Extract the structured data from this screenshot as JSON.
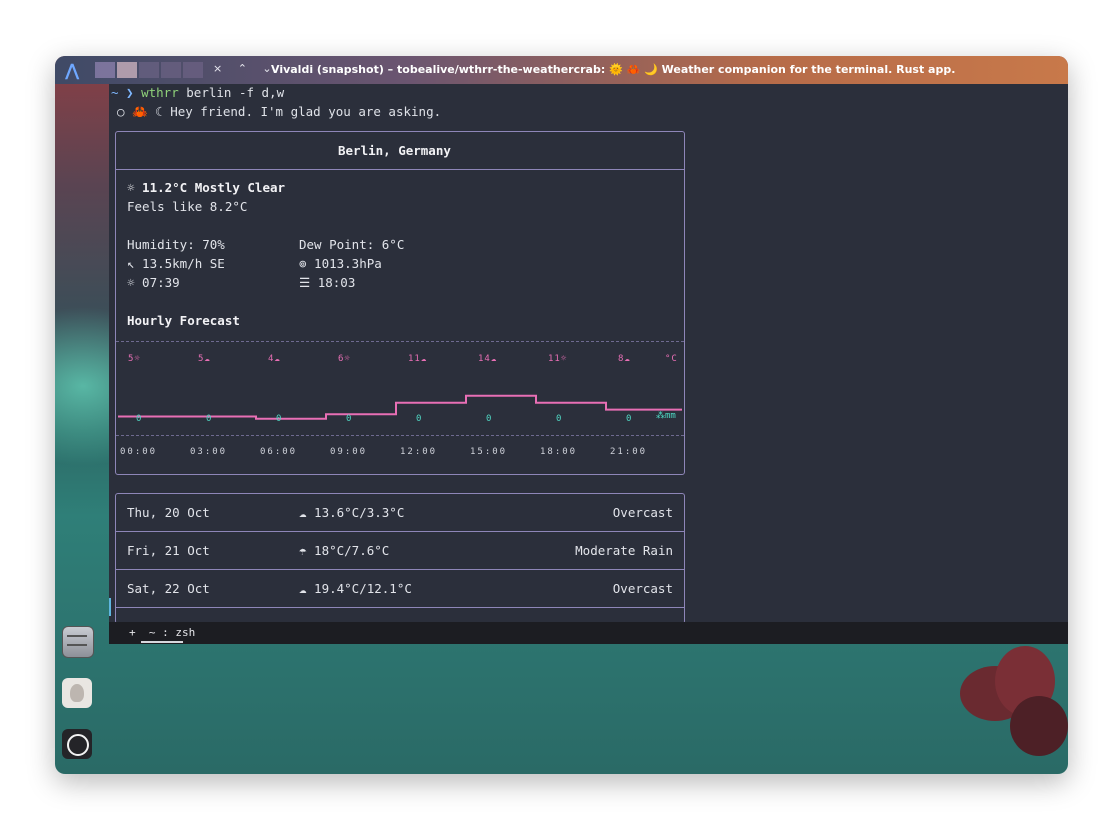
{
  "window": {
    "title": "Vivaldi (snapshot) – tobealive/wthrr-the-weathercrab: 🌞 🦀 🌙 Weather companion for the terminal. Rust app.",
    "controls": "×  ⌃  ⌄"
  },
  "terminal": {
    "prompt_symbol": "~ ❯",
    "command": "wthrr",
    "args": " berlin -f d,w",
    "greeting": "○ 🦀 ☾ Hey friend. I'm glad you are asking.",
    "current": {
      "location": "Berlin, Germany",
      "summary": "☼ 11.2°C Mostly Clear",
      "feels_like": "Feels like 8.2°C",
      "humidity": "Humidity: 70%",
      "dew_point": "Dew Point: 6°C",
      "wind": "↖ 13.5km/h SE",
      "pressure": "⊚ 1013.3hPa",
      "sunrise": "☼ 07:39",
      "sunset": "☰ 18:03",
      "hourly_heading": "Hourly Forecast"
    },
    "hourly": {
      "temp_unit": "°C",
      "precip_unit": "mm",
      "temps": [
        "5☼",
        "5☁",
        "4☁",
        "6☼",
        "11☁",
        "14☁",
        "11☼",
        "8☁"
      ],
      "precip": [
        "0",
        "0",
        "0",
        "0",
        "0",
        "0",
        "0",
        "0"
      ],
      "times": [
        "00:00",
        "03:00",
        "06:00",
        "09:00",
        "12:00",
        "15:00",
        "18:00",
        "21:00"
      ],
      "accent": "#e86fb5",
      "precip_color": "#4fd7c3"
    },
    "daily": [
      {
        "date": "Thu, 20 Oct",
        "temps": "☁ 13.6°C/3.3°C",
        "condition": "Overcast"
      },
      {
        "date": "Fri, 21 Oct",
        "temps": "☂ 18°C/7.6°C",
        "condition": "Moderate Rain"
      },
      {
        "date": "Sat, 22 Oct",
        "temps": "☁ 19.4°C/12.1°C",
        "condition": "Overcast"
      }
    ]
  },
  "tabbar": {
    "tab_label": "+  ~ : zsh"
  },
  "dock": {
    "icons": [
      "file-cabinet-icon",
      "cat-app-icon",
      "settings-app-icon"
    ]
  }
}
